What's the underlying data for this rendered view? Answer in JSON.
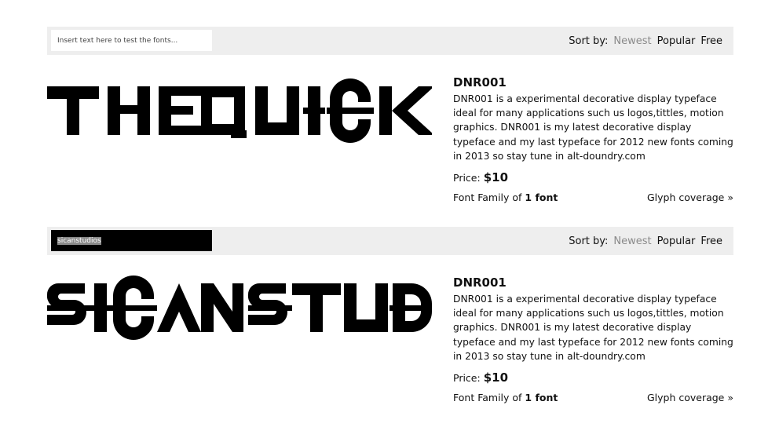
{
  "rows": [
    {
      "input_placeholder": "Insert text here to test the fonts...",
      "input_value": "",
      "sort_label": "Sort by:",
      "sort_options": [
        "Newest",
        "Popular",
        "Free"
      ],
      "active_sort": "Newest",
      "specimen_text": "THE QUICK",
      "font_name": "DNR001",
      "description": "DNR001 is a experimental decorative display typeface ideal for many applications such us logos,tittles, motion graphics. DNR001 is my latest decorative display typeface and my last typeface for 2012 new fonts coming in 2013 so stay tune in alt-doundry.com",
      "price_label": "Price:",
      "price_value": "$10",
      "family_prefix": "Font Family of",
      "family_count": "1 font",
      "glyph_link": "Glyph coverage »"
    },
    {
      "input_placeholder": "",
      "input_value": "sicanstudios",
      "sort_label": "Sort by:",
      "sort_options": [
        "Newest",
        "Popular",
        "Free"
      ],
      "active_sort": "Newest",
      "specimen_text": "SICANSTUDI",
      "font_name": "DNR001",
      "description": "DNR001 is a experimental decorative display typeface ideal for many applications such us logos,tittles, motion graphics. DNR001 is my latest decorative display typeface and my last typeface for 2012 new fonts coming in 2013 so stay tune in alt-doundry.com",
      "price_label": "Price:",
      "price_value": "$10",
      "family_prefix": "Font Family of",
      "family_count": "1 font",
      "glyph_link": "Glyph coverage »"
    }
  ],
  "colors": {
    "toolbar_bg": "#eeeeee",
    "active_sort": "#8a8a8a",
    "text": "#111111"
  }
}
